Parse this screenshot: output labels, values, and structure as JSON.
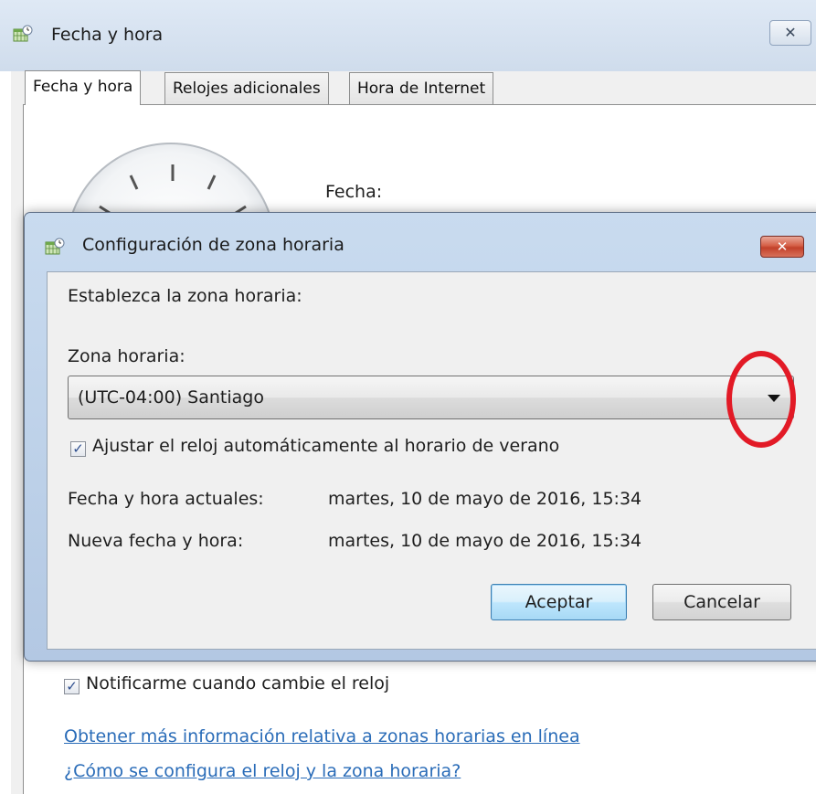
{
  "back_window": {
    "title": "Fecha y hora",
    "close_glyph": "✕",
    "tabs": [
      {
        "label": "Fecha y hora",
        "active": true
      },
      {
        "label": "Relojes adicionales",
        "active": false
      },
      {
        "label": "Hora de Internet",
        "active": false
      }
    ],
    "date_label": "Fecha:",
    "notify_checkbox": {
      "label": "Notificarme cuando cambie el reloj",
      "checked": true
    },
    "links": [
      "Obtener más información relativa a zonas horarias en línea",
      "¿Cómo se configura el reloj y la zona horaria?"
    ]
  },
  "dialog": {
    "title": "Configuración de zona horaria",
    "close_glyph": "✕",
    "instruction": "Establezca la zona horaria:",
    "timezone_label": "Zona horaria:",
    "timezone_value": "(UTC-04:00) Santiago",
    "dst_checkbox": {
      "label": "Ajustar el reloj automáticamente al horario de verano",
      "checked": true
    },
    "current_label": "Fecha y hora actuales:",
    "current_value": "martes, 10 de mayo de 2016, 15:34",
    "new_label": "Nueva fecha y hora:",
    "new_value": "martes, 10 de mayo de 2016, 15:34",
    "ok_button": "Aceptar",
    "cancel_button": "Cancelar"
  },
  "check_glyph": "✓",
  "annotation_color": "#e21a26",
  "icons": [
    "calendar-clock-icon",
    "close-icon",
    "dropdown-arrow-icon",
    "checkmark-icon"
  ]
}
